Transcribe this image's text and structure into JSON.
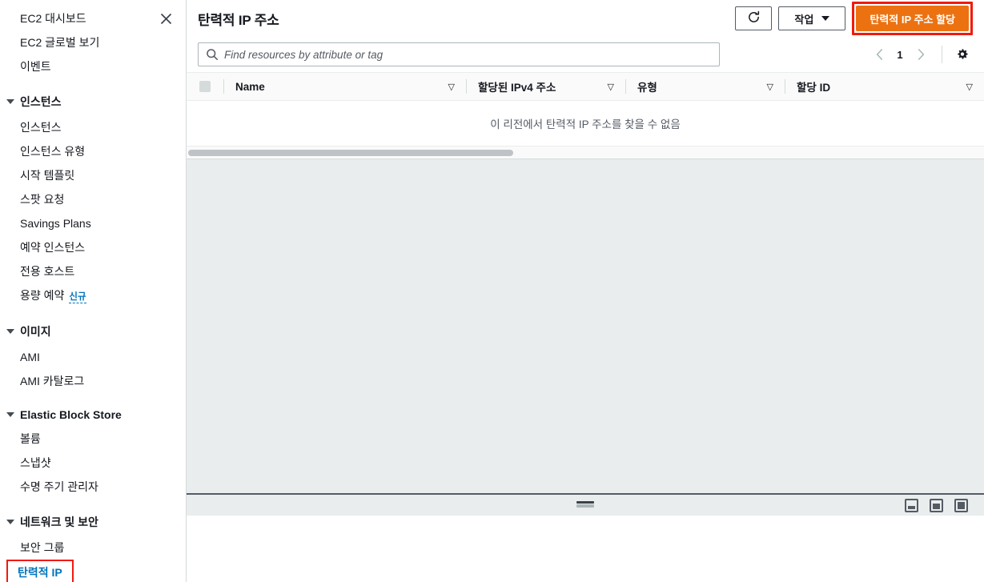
{
  "sidebar": {
    "close_icon": "close-icon",
    "items": [
      {
        "type": "link",
        "label": "EC2 대시보드"
      },
      {
        "type": "link",
        "label": "EC2 글로벌 보기"
      },
      {
        "type": "link",
        "label": "이벤트"
      },
      {
        "type": "group",
        "label": "인스턴스"
      },
      {
        "type": "link",
        "label": "인스턴스"
      },
      {
        "type": "link",
        "label": "인스턴스 유형"
      },
      {
        "type": "link",
        "label": "시작 템플릿"
      },
      {
        "type": "link",
        "label": "스팟 요청"
      },
      {
        "type": "link",
        "label": "Savings Plans"
      },
      {
        "type": "link",
        "label": "예약 인스턴스"
      },
      {
        "type": "link",
        "label": "전용 호스트"
      },
      {
        "type": "link",
        "label": "용량 예약",
        "badge": "신규"
      },
      {
        "type": "group",
        "label": "이미지"
      },
      {
        "type": "link",
        "label": "AMI"
      },
      {
        "type": "link",
        "label": "AMI 카탈로그"
      },
      {
        "type": "group",
        "label": "Elastic Block Store"
      },
      {
        "type": "link",
        "label": "볼륨"
      },
      {
        "type": "link",
        "label": "스냅샷"
      },
      {
        "type": "link",
        "label": "수명 주기 관리자"
      },
      {
        "type": "group",
        "label": "네트워크 및 보안"
      },
      {
        "type": "link",
        "label": "보안 그룹"
      },
      {
        "type": "link",
        "label": "탄력적 IP",
        "selected": true,
        "highlighted": true
      }
    ]
  },
  "header": {
    "title": "탄력적 IP 주소",
    "refresh_icon": "refresh-icon",
    "actions_label": "작업",
    "actions_caret_icon": "chevron-down-icon",
    "allocate_label": "탄력적 IP 주소 할당",
    "allocate_highlighted": true
  },
  "search": {
    "icon": "search-icon",
    "value": "",
    "placeholder": "Find resources by attribute or tag"
  },
  "pagination": {
    "prev_icon": "chevron-left-icon",
    "page": "1",
    "next_icon": "chevron-right-icon",
    "settings_icon": "gear-icon"
  },
  "table": {
    "select_all_checkbox": "select-all-checkbox",
    "columns": [
      {
        "label": "Name",
        "sort_icon": "sort-icon"
      },
      {
        "label": "할당된 IPv4 주소",
        "sort_icon": "sort-icon"
      },
      {
        "label": "유형",
        "sort_icon": "sort-icon"
      },
      {
        "label": "할당 ID",
        "sort_icon": "sort-icon"
      }
    ],
    "rows": [],
    "empty_message": "이 리전에서 탄력적 IP 주소를 찾을 수 없음"
  },
  "split_panel": {
    "drag_handle": "split-panel-drag-handle",
    "layout_buttons": [
      {
        "name": "layout-bottom-small-icon"
      },
      {
        "name": "layout-bottom-medium-icon"
      },
      {
        "name": "layout-full-icon"
      }
    ]
  },
  "colors": {
    "accent_orange": "#ec7211",
    "highlight_red": "#f11a0d",
    "link_blue": "#0073bb",
    "page_bg": "#eaeded",
    "border": "#d5dbdb"
  }
}
